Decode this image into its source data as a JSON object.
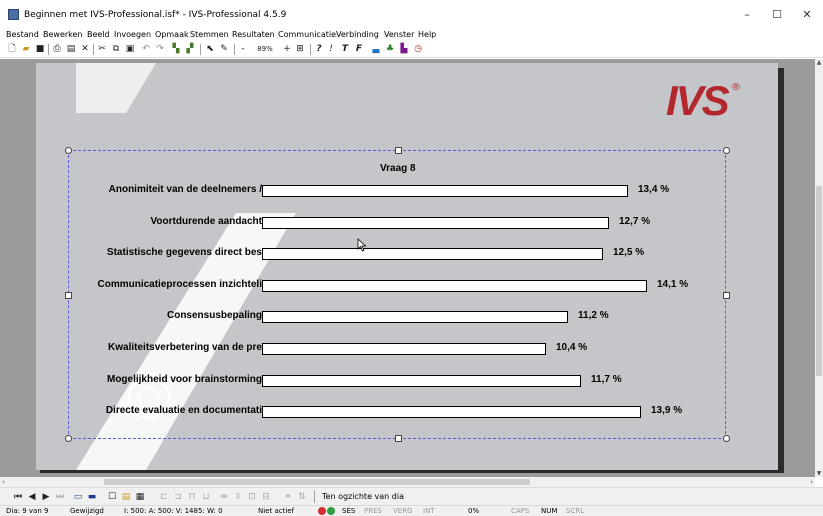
{
  "window": {
    "title": "Beginnen met IVS-Professional.isf* - IVS-Professional 4.5.9",
    "minimize": "–",
    "maximize": "☐",
    "close": "✕"
  },
  "menu": [
    "Bestand",
    "Bewerken",
    "Beeld",
    "Invoegen",
    "Opmaak",
    "Stemmen",
    "Resultaten",
    "Communicatie",
    "Verbinding",
    "Venster",
    "Help"
  ],
  "toolbar": {
    "zoom": "89%",
    "zoom_minus": "-",
    "zoom_plus": "+",
    "help": "?",
    "info": "!",
    "text_t": "T",
    "text_f": "F"
  },
  "slide": {
    "logo": "IVS",
    "logo_mark": "®"
  },
  "chart_data": {
    "type": "bar",
    "title": "Vraag 8",
    "categories": [
      "Anonimiteit van de deelnemers /",
      "Voortdurende aandacht",
      "Statistische gegevens direct bes",
      "Communicatieprocessen inzichteli",
      "Consensusbepaling",
      "Kwaliteitsverbetering van de pre",
      "Mogelijkheid voor brainstorming",
      "Directe evaluatie en documentati"
    ],
    "values": [
      13.4,
      12.7,
      12.5,
      14.1,
      11.2,
      10.4,
      11.7,
      13.9
    ],
    "value_labels": [
      "13,4 %",
      "12,7 %",
      "12,5 %",
      "14,1 %",
      "11,2 %",
      "10,4 %",
      "11,7 %",
      "13,9 %"
    ],
    "xlabel": "",
    "ylabel": "",
    "grid": false,
    "legend": "none"
  },
  "bottom_toolbar": {
    "first": "⏮",
    "prev": "◀",
    "next": "▶",
    "last": "⏭",
    "overview_label": "Ten ogzichte van dia"
  },
  "status": {
    "slide": "Dia: 9 van 9",
    "modified": "Gewijzigd",
    "coords": "I: 500:  A: 500:  V: 1485:  W: 0",
    "state": "Niet actief",
    "ses": "SES",
    "pres": "PRES",
    "verg": "VERG",
    "int": "INT",
    "percent": "0%",
    "caps": "CAPS",
    "num": "NUM",
    "scrl": "SCRL"
  },
  "colors": {
    "logo": "#b3282c",
    "slide_bg": "#c4c6c9",
    "selection": "#5a5fd8",
    "led_red": "#d32f2f",
    "led_green": "#2e9c3e"
  }
}
